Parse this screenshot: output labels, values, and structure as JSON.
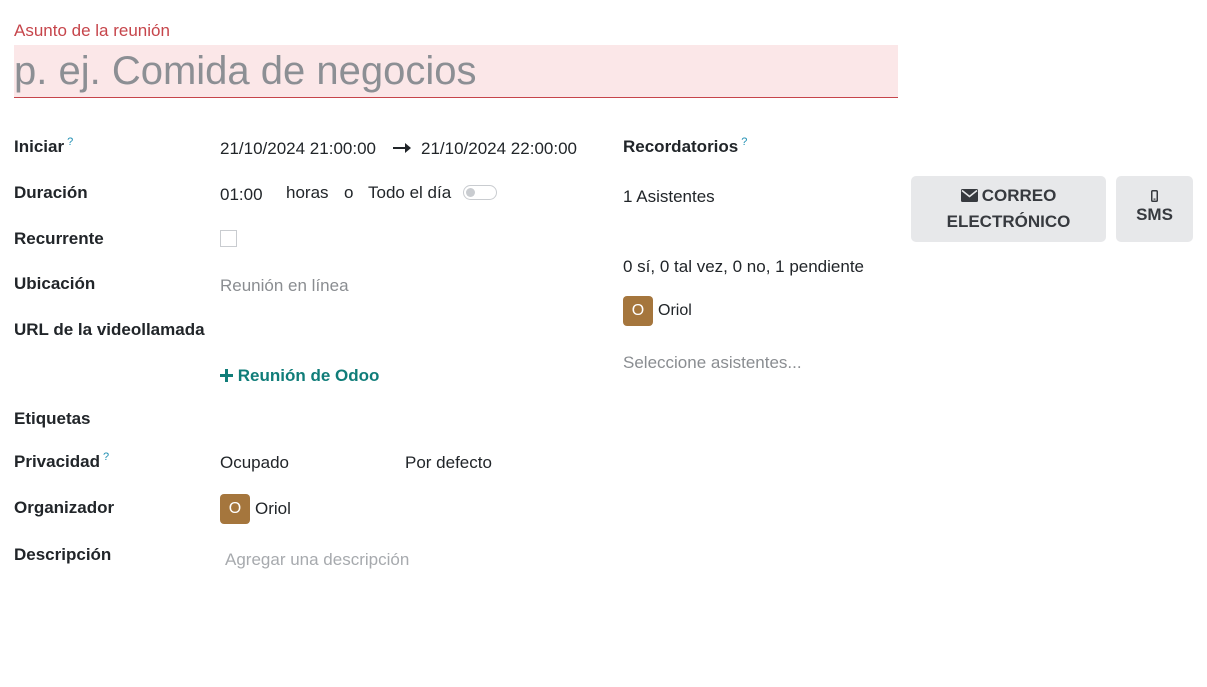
{
  "subject": {
    "label": "Asunto de la reunión",
    "placeholder": "p. ej. Comida de negocios"
  },
  "fields": {
    "start": {
      "label": "Iniciar",
      "help": "?",
      "from": "21/10/2024 21:00:00",
      "to": "21/10/2024 22:00:00"
    },
    "duration": {
      "label": "Duración",
      "value": "01:00",
      "unit": "horas",
      "or": "o",
      "all_day": "Todo el día",
      "all_day_on": false
    },
    "recurrent": {
      "label": "Recurrente",
      "checked": false
    },
    "location": {
      "label": "Ubicación",
      "placeholder": "Reunión en línea"
    },
    "video_url": {
      "label": "URL de la videollamada",
      "action": "Reunión de Odoo"
    },
    "tags": {
      "label": "Etiquetas"
    },
    "privacy": {
      "label": "Privacidad",
      "help": "?",
      "show_as": "Ocupado",
      "privacy": "Por defecto"
    },
    "organizer": {
      "label": "Organizador",
      "avatar": "O",
      "name": "Oriol"
    },
    "description": {
      "label": "Descripción",
      "placeholder": "Agregar una descripción"
    }
  },
  "right": {
    "reminders": {
      "label": "Recordatorios",
      "help": "?"
    },
    "attendees_count": "1 Asistentes",
    "attendance_summary": "0 sí, 0 tal vez, 0 no, 1 pendiente",
    "attendee": {
      "avatar": "O",
      "name": "Oriol"
    },
    "select_placeholder": "Seleccione asistentes..."
  },
  "buttons": {
    "email_line1": "CORREO",
    "email_line2": "ELECTRÓNICO",
    "sms": "SMS"
  },
  "colors": {
    "accent_red": "#c6454b",
    "link_teal": "#107d79",
    "avatar_bg": "#a5763d",
    "help_blue": "#1f8fb3"
  }
}
